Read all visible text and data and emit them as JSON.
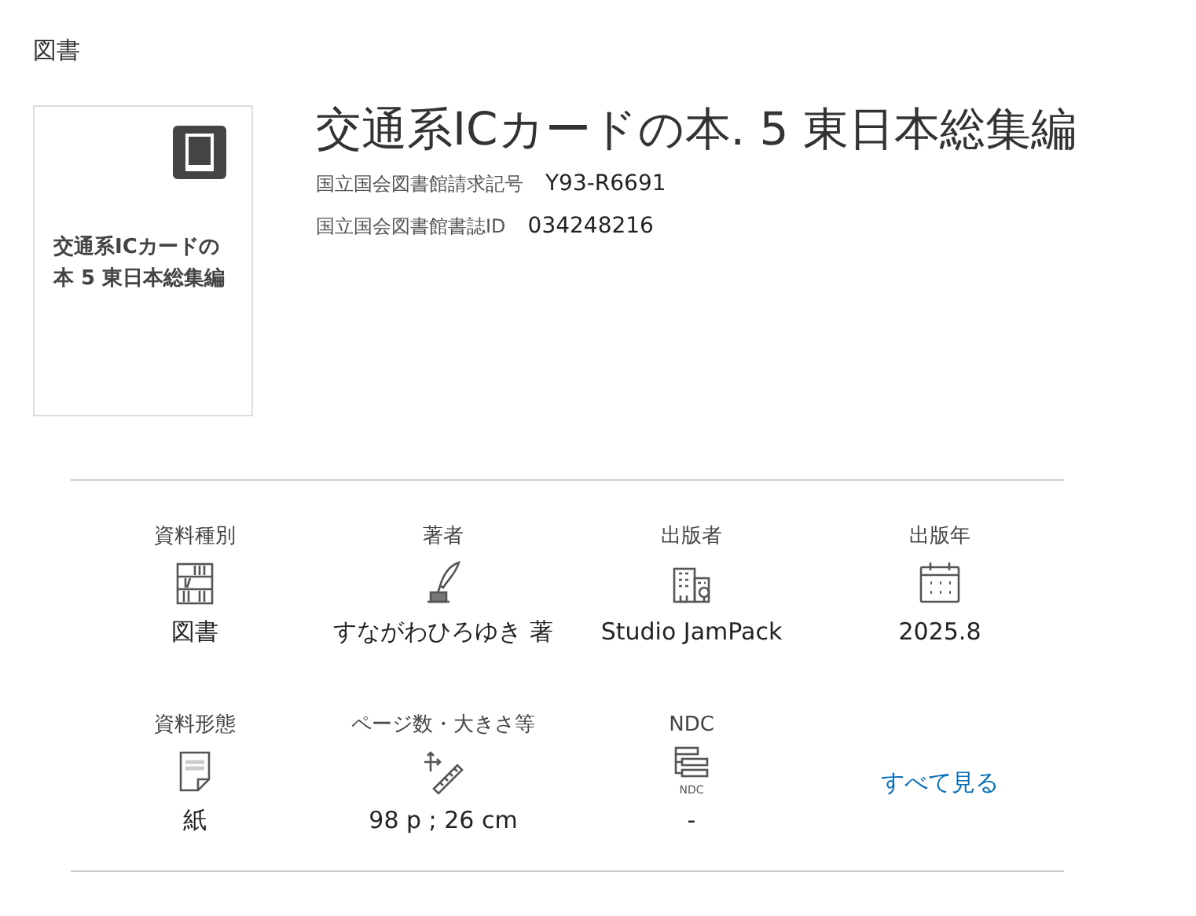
{
  "category": "図書",
  "thumbnail": {
    "title": "交通系ICカードの本 5 東日本総集編"
  },
  "title": "交通系ICカードの本. 5 東日本総集編",
  "identifiers": [
    {
      "label": "国立国会図書館請求記号",
      "value": "Y93-R6691"
    },
    {
      "label": "国立国会図書館書誌ID",
      "value": "034248216"
    }
  ],
  "details": [
    {
      "kind": "field",
      "label": "資料種別",
      "value": "図書"
    },
    {
      "kind": "field",
      "label": "著者",
      "value": "すながわひろゆき 著"
    },
    {
      "kind": "field",
      "label": "出版者",
      "value": "Studio JamPack"
    },
    {
      "kind": "field",
      "label": "出版年",
      "value": "2025.8"
    },
    {
      "kind": "field",
      "label": "資料形態",
      "value": "紙"
    },
    {
      "kind": "field",
      "label": "ページ数・大きさ等",
      "value": "98 p ; 26 cm"
    },
    {
      "kind": "field",
      "label": "NDC",
      "value": "-",
      "icon_caption": "NDC"
    },
    {
      "kind": "link",
      "label": "すべて見る"
    }
  ]
}
